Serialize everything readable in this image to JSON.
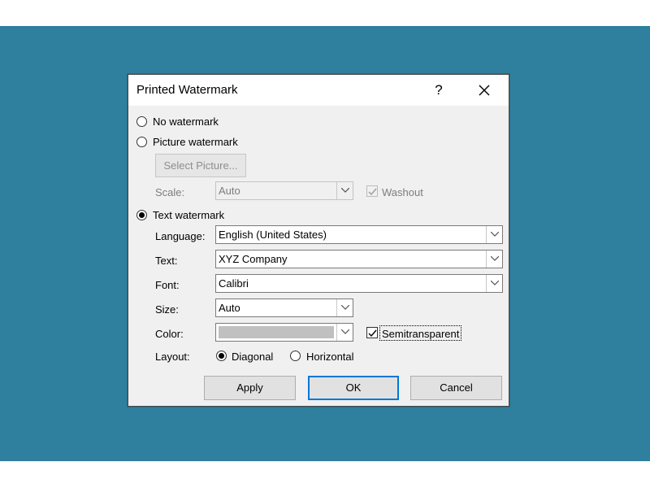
{
  "dialog": {
    "title": "Printed Watermark",
    "help": "?"
  },
  "options": {
    "no_watermark": "No watermark",
    "picture_watermark": "Picture watermark",
    "text_watermark": "Text watermark",
    "selected": "text_watermark"
  },
  "picture": {
    "select_button": "Select Picture...",
    "scale_label": "Scale:",
    "scale_value": "Auto",
    "washout_label": "Washout",
    "washout_checked": true
  },
  "text": {
    "language_label": "Language:",
    "language_value": "English (United States)",
    "text_label": "Text:",
    "text_value": "XYZ Company",
    "font_label": "Font:",
    "font_value": "Calibri",
    "size_label": "Size:",
    "size_value": "Auto",
    "color_label": "Color:",
    "color_swatch": "#c0c0c0",
    "semitransparent_label": "Semitransparent",
    "semitransparent_checked": true,
    "layout_label": "Layout:",
    "layout_diagonal": "Diagonal",
    "layout_horizontal": "Horizontal",
    "layout_selected": "diagonal"
  },
  "buttons": {
    "apply": "Apply",
    "ok": "OK",
    "cancel": "Cancel"
  },
  "colors": {
    "backdrop": "#2f7f9e",
    "accent": "#0078d7"
  }
}
